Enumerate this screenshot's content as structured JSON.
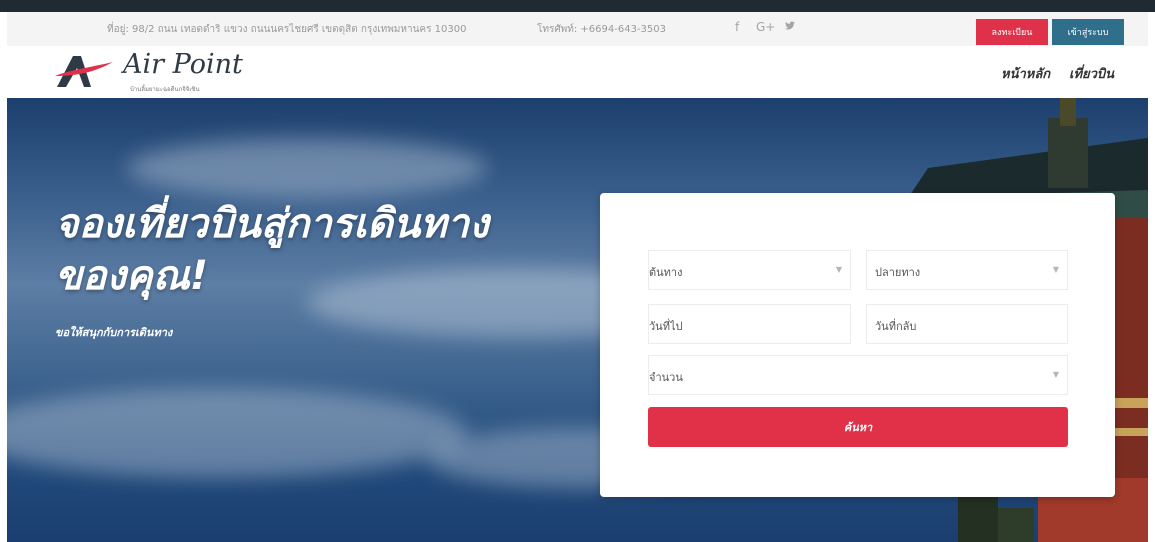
{
  "topbar": {
    "address": "ที่อยู่: 98/2 ถนน เทอดดำริ แขวง ถนนนครไชยศรี เขตดุสิต กรุงเทพมหานคร 10300",
    "phone": "โทรศัพท์: +6694-643-3503",
    "social": [
      {
        "icon": "facebook-icon",
        "glyph": "f"
      },
      {
        "icon": "google-plus-icon",
        "glyph": "G+"
      },
      {
        "icon": "twitter-icon",
        "glyph": "𝕥"
      }
    ],
    "register_label": "ลงทะเบียน",
    "login_label": "เข้าสู่ระบบ"
  },
  "brand": {
    "name": "Air Point",
    "tagline": "บ้านลิ้มยามะฉอดีนกจิจิเขิน"
  },
  "nav": {
    "items": [
      "หน้าหลัก",
      "เที่ยวบิน"
    ]
  },
  "hero": {
    "title_line1": "จองเที่ยวบินสู่การเดินทาง",
    "title_line2": "ของคุณ!",
    "subtitle": "ขอให้สนุกกับการเดินทาง"
  },
  "form": {
    "origin_label": "ต้นทาง",
    "destination_label": "ปลายทาง",
    "depart_label": "วันที่ไป",
    "return_label": "วันที่กลับ",
    "passengers_label": "จำนวน",
    "search_label": "ค้นหา"
  },
  "colors": {
    "accent_red": "#e0314a",
    "login_blue": "#2f6f8c",
    "hero_blue": "#2f5a8a"
  }
}
